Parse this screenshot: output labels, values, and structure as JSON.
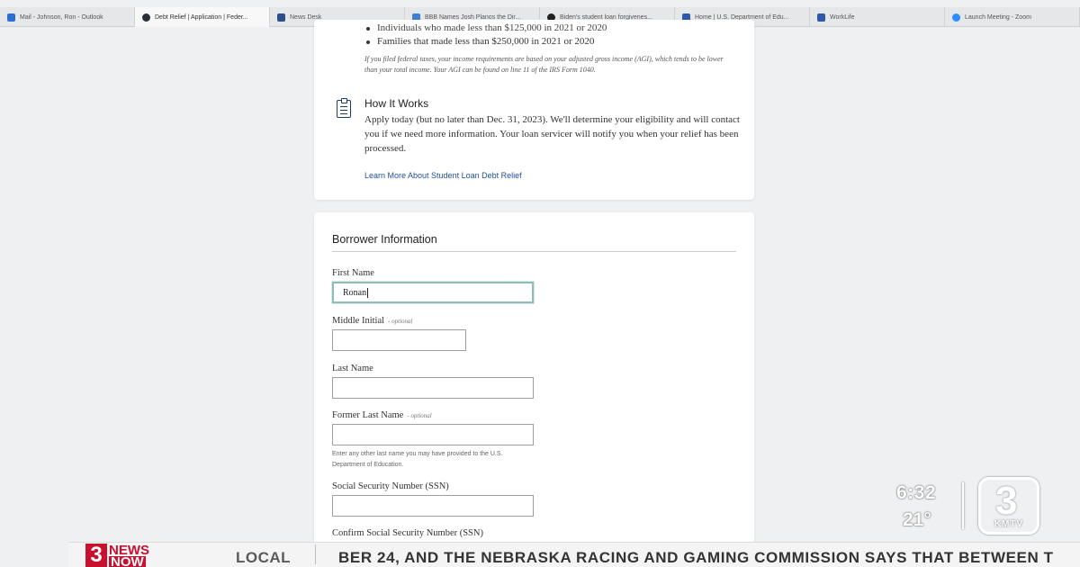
{
  "browser": {
    "tabs": [
      {
        "label": "Mail - Johnson, Ron - Outlook",
        "icon": "outlook-icon",
        "color": "#2b6fd6",
        "active": false
      },
      {
        "label": "Debt Relief | Application | Feder...",
        "icon": "federal-seal-icon",
        "color": "#2a2f3a",
        "active": true
      },
      {
        "label": "News Desk",
        "icon": "news-desk-icon",
        "color": "#2e4e8c",
        "active": false
      },
      {
        "label": "BBB Names Josh Planos the Dir...",
        "icon": "bbb-icon",
        "color": "#3f7fd0",
        "active": false
      },
      {
        "label": "Biden's student loan forgivenes...",
        "icon": "news-site-icon",
        "color": "#222222",
        "active": false
      },
      {
        "label": "Home | U.S. Department of Edu...",
        "icon": "ed-gov-icon",
        "color": "#2d5aa8",
        "active": false
      },
      {
        "label": "WorkLife",
        "icon": "worklife-icon",
        "color": "#3058a8",
        "active": false
      },
      {
        "label": "Launch Meeting - Zoom",
        "icon": "zoom-icon",
        "color": "#2d8cff",
        "active": false
      }
    ]
  },
  "eligibility": {
    "bullets": [
      "Individuals who made less than $125,000 in 2021 or 2020",
      "Families that made less than $250,000 in 2021 or 2020"
    ],
    "agi_note": "If you filed federal taxes, your income requirements are based on your adjusted gross income (AGI), which tends to be lower than your total income. Your AGI can be found on line 11 of the IRS Form 1040."
  },
  "how_it_works": {
    "title": "How It Works",
    "body": "Apply today (but no later than Dec. 31, 2023). We'll determine your eligibility and will contact you if we need more information. Your loan servicer will notify you when your relief has been processed.",
    "link": "Learn More About Student Loan Debt Relief"
  },
  "borrower": {
    "title": "Borrower Information",
    "first_name": {
      "label": "First Name",
      "value": "Ronan"
    },
    "middle_initial": {
      "label": "Middle Initial",
      "optional": "- optional",
      "value": ""
    },
    "last_name": {
      "label": "Last Name",
      "value": ""
    },
    "former_last_name": {
      "label": "Former Last Name",
      "optional": "- optional",
      "value": "",
      "helper": "Enter any other last name you may have provided to the U.S. Department of Education."
    },
    "ssn": {
      "label": "Social Security Number (SSN)",
      "value": ""
    },
    "confirm_ssn": {
      "label": "Confirm Social Security Number (SSN)"
    }
  },
  "broadcast": {
    "time": "6:32",
    "temperature": "21°",
    "station_number": "3",
    "call_sign": "KMTV",
    "news_logo": {
      "number": "3",
      "line1": "NEWS",
      "line2": "NOW"
    },
    "ticker_label": "LOCAL",
    "ticker_text": "BER 24, AND THE NEBRASKA RACING AND GAMING COMMISSION SAYS THAT BETWEEN T",
    "brand_red": "#c9102e"
  }
}
